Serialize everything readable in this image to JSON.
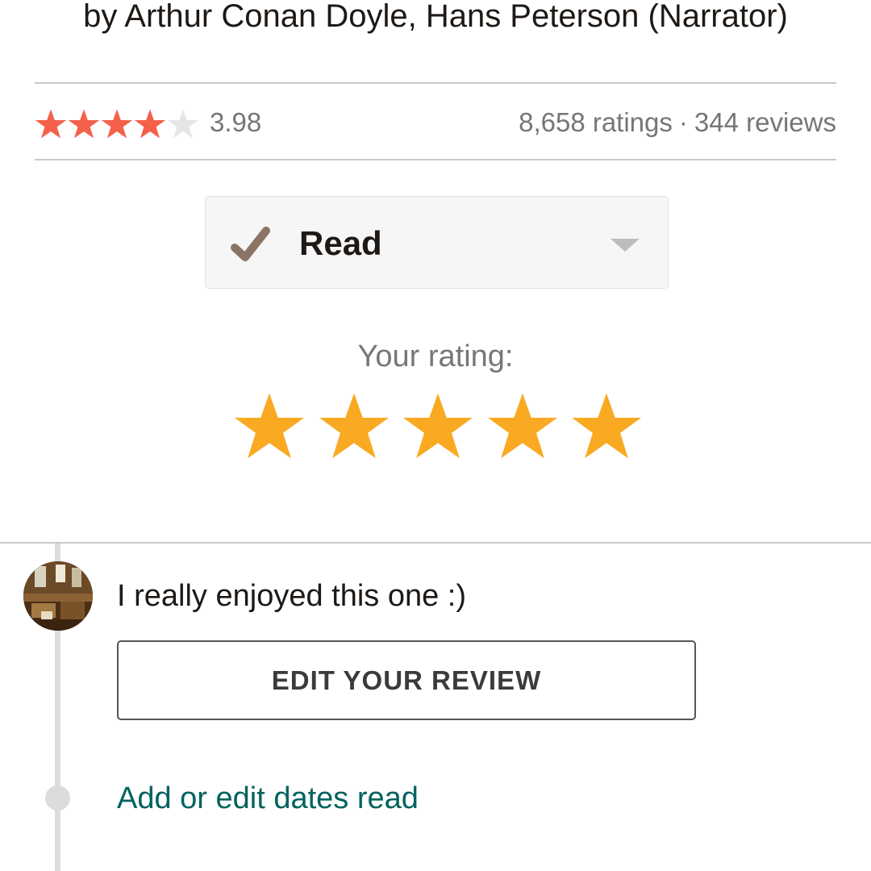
{
  "book": {
    "byline_prefix": "by",
    "authors": "Arthur Conan Doyle, Hans Peterson (Narrator)"
  },
  "community_rating": {
    "average": "3.98",
    "average_value": 3.98,
    "max_stars": 5,
    "filled_stars": 4,
    "ratings_count": "8,658 ratings",
    "separator": "·",
    "reviews_count": "344 reviews",
    "star_color": "#f5604a",
    "empty_star_color": "#e6e6e6"
  },
  "shelf": {
    "label": "Read",
    "icon": "checkmark-icon",
    "dropdown_icon": "caret-down-icon",
    "check_color": "#8c7466"
  },
  "user_rating": {
    "label": "Your rating:",
    "value": 5,
    "max": 5,
    "star_color": "#f9aa22"
  },
  "review": {
    "text": "I really enjoyed this one :)",
    "edit_button_label": "EDIT YOUR REVIEW",
    "dates_link_label": "Add or edit dates read",
    "link_color": "#00635d"
  }
}
